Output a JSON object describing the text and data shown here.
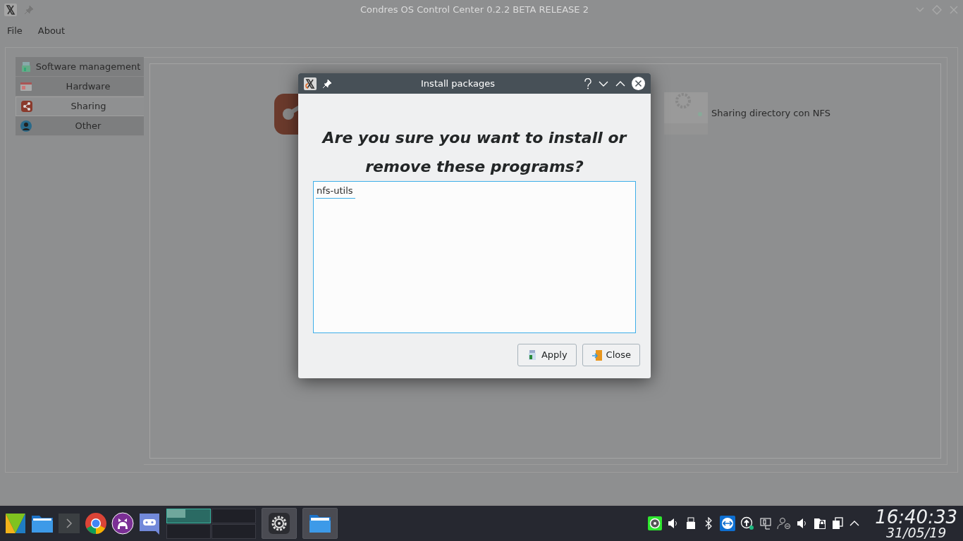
{
  "window": {
    "title": "Condres OS Control Center 0.2.2 BETA RELEASE 2"
  },
  "menu": [
    "File",
    "About"
  ],
  "sidebar": {
    "items": [
      {
        "label": "Software management",
        "selected": false,
        "kind": "software"
      },
      {
        "label": "Hardware",
        "selected": false,
        "kind": "hardware"
      },
      {
        "label": "Sharing",
        "selected": true,
        "kind": "sharing"
      },
      {
        "label": "Other",
        "selected": false,
        "kind": "other"
      }
    ]
  },
  "content": {
    "items": [
      {
        "label": "Sharing directory con NFS"
      }
    ]
  },
  "dialog": {
    "title": "Install packages",
    "question": "Are you sure you want to install or remove these programs?",
    "packages": [
      "nfs-utils"
    ],
    "buttons": [
      {
        "label": "Apply",
        "kind": "apply"
      },
      {
        "label": "Close",
        "kind": "close"
      }
    ]
  },
  "taskbar": {
    "desktops": [
      {
        "selected": true
      },
      {
        "selected": false
      },
      {
        "selected": false
      },
      {
        "selected": false
      }
    ],
    "clock": {
      "time": "16:40:33",
      "date": "31/05/19"
    }
  }
}
